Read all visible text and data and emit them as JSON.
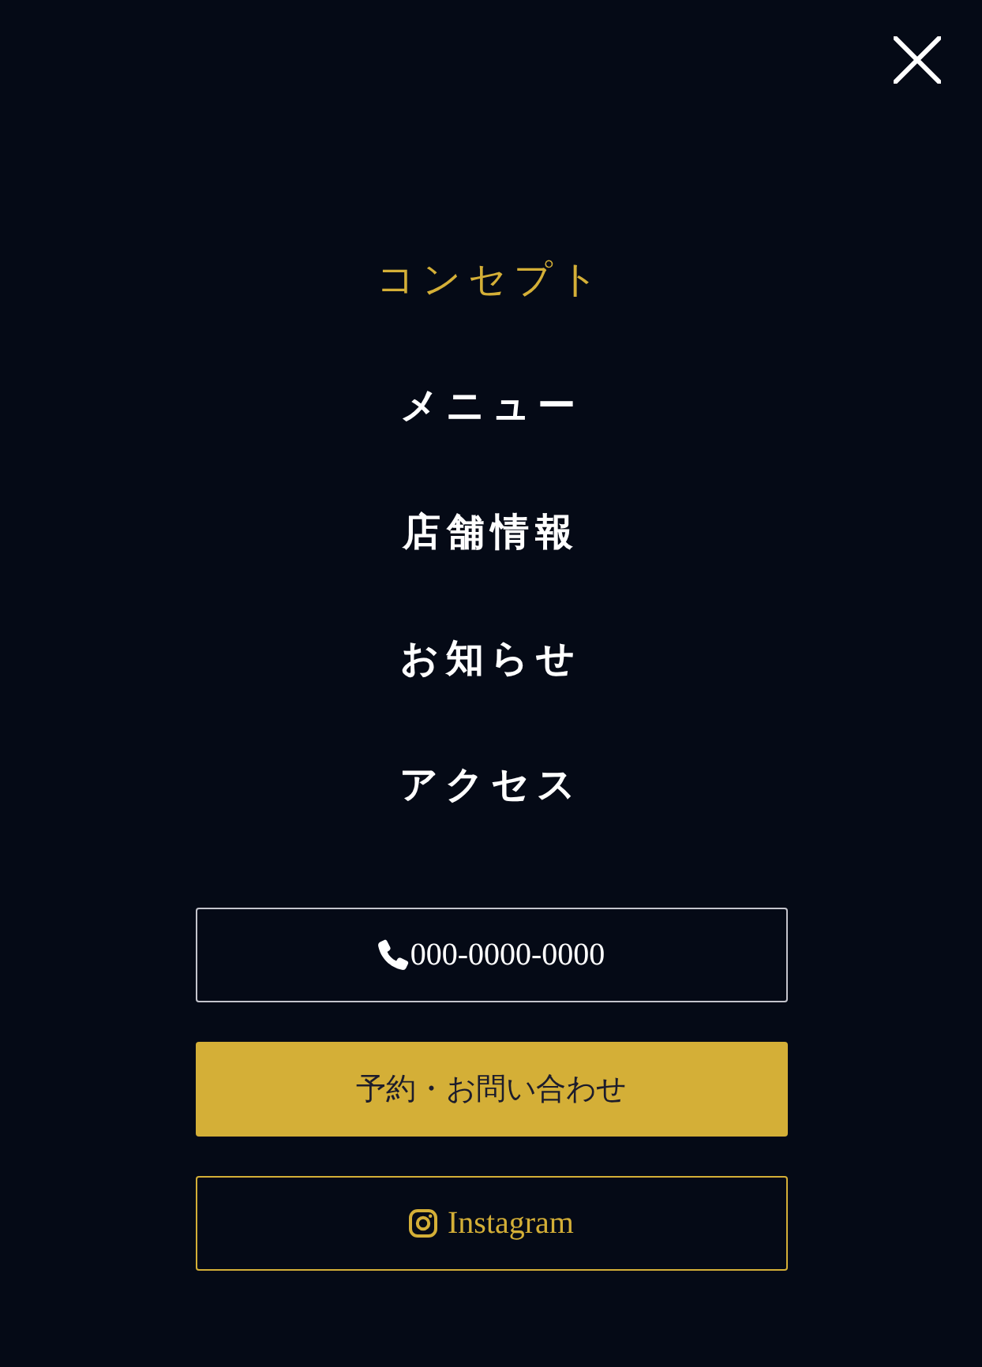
{
  "menu": [
    {
      "label": "コンセプト",
      "selected": true
    },
    {
      "label": "メニュー",
      "selected": false
    },
    {
      "label": "店舗情報",
      "selected": false
    },
    {
      "label": "お知らせ",
      "selected": false
    },
    {
      "label": "アクセス",
      "selected": false
    }
  ],
  "buttons": [
    {
      "kind": "phone",
      "label": "000-0000-0000"
    },
    {
      "kind": "reserve",
      "label": "予約・お問い合わせ"
    },
    {
      "kind": "instagram",
      "label": "Instagram"
    }
  ]
}
